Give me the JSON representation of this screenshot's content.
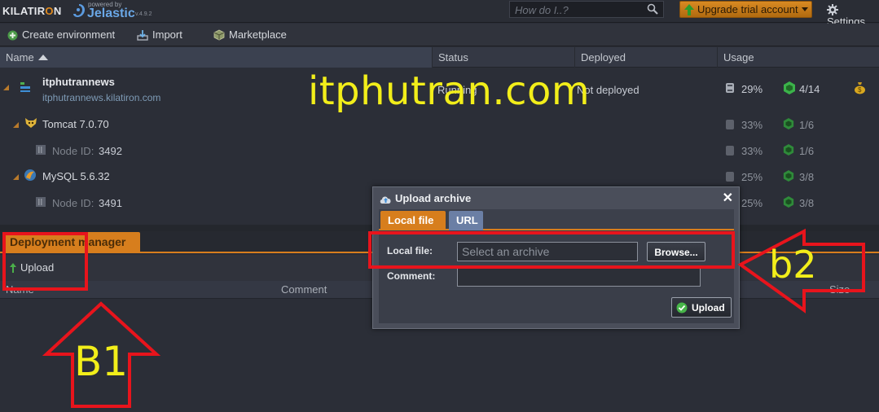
{
  "topbar": {
    "brand_prefix": "KILATIR",
    "brand_o": "O",
    "brand_suffix": "N",
    "powered_by": "powered by",
    "jelastic": "Jelastic",
    "version": "v.4.9.2",
    "search_placeholder": "How do I..?",
    "upgrade_label": "Upgrade trial account",
    "settings_label": "Settings"
  },
  "toolbar": {
    "create_env": "Create environment",
    "import": "Import",
    "marketplace": "Marketplace"
  },
  "grid": {
    "columns": [
      "Name",
      "Status",
      "Deployed",
      "Usage"
    ],
    "env": {
      "name": "itphutrannews",
      "url": "itphutrannews.kilatiron.com",
      "status": "Running",
      "deployed": "Not deployed",
      "disk": "29%",
      "cloudlets": "4/14"
    },
    "rows": [
      {
        "name": "Tomcat 7.0.70",
        "disk": "33%",
        "cloudlets": "1/6"
      },
      {
        "node_label": "Node ID:",
        "node_id": "3492",
        "disk": "33%",
        "cloudlets": "1/6"
      },
      {
        "name": "MySQL 5.6.32",
        "disk": "25%",
        "cloudlets": "3/8"
      },
      {
        "node_label": "Node ID:",
        "node_id": "3491",
        "disk": "25%",
        "cloudlets": "3/8"
      }
    ]
  },
  "deployment_manager": {
    "tab": "Deployment manager",
    "upload": "Upload",
    "columns": [
      "Name",
      "Comment",
      "Size"
    ]
  },
  "dialog": {
    "title": "Upload archive",
    "close": "✕",
    "tabs": [
      "Local file",
      "URL"
    ],
    "local_file_label": "Local file:",
    "local_file_placeholder": "Select an archive",
    "browse": "Browse...",
    "comment_label": "Comment:",
    "upload": "Upload"
  },
  "annotations": {
    "watermark": "itphutran.com",
    "b1": "B1",
    "b2": "b2"
  },
  "colors": {
    "accent_orange": "#d77e1d",
    "annotation_red": "#e8141c",
    "annotation_yellow": "#f2ee1a",
    "status_green": "#3bb34a"
  }
}
